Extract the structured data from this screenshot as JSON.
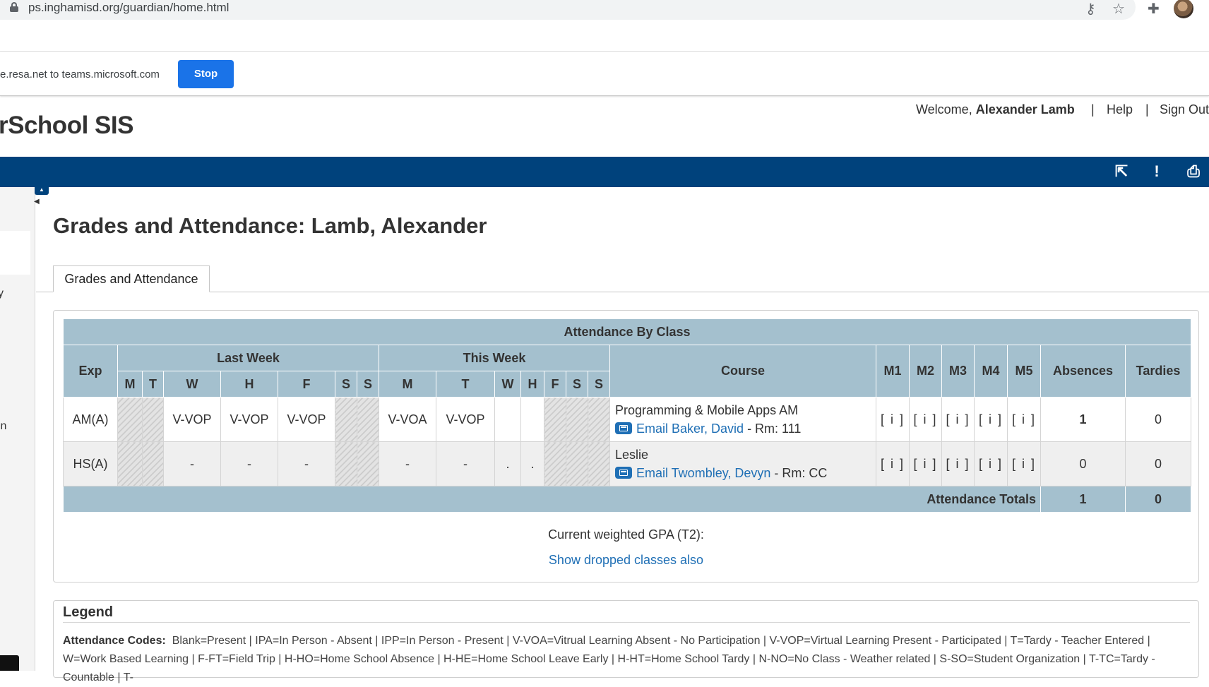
{
  "browser": {
    "url": "ps.inghamisd.org/guardian/home.html",
    "share_text": "e.resa.net to teams.microsoft.com",
    "stop_label": "Stop"
  },
  "header": {
    "brand": "rSchool SIS",
    "welcome_prefix": "Welcome, ",
    "user_name": "Alexander Lamb",
    "help": "Help",
    "sign_out": "Sign Out",
    "separator": "|"
  },
  "sidebar": {
    "fragments": [
      "y",
      "in"
    ]
  },
  "page": {
    "title": "Grades and Attendance: Lamb, Alexander",
    "tab": "Grades and Attendance"
  },
  "attendance": {
    "caption": "Attendance By Class",
    "headers": {
      "exp": "Exp",
      "last_week": "Last Week",
      "this_week": "This Week",
      "course": "Course",
      "m1": "M1",
      "m2": "M2",
      "m3": "M3",
      "m4": "M4",
      "m5": "M5",
      "absences": "Absences",
      "tardies": "Tardies"
    },
    "days": [
      "M",
      "T",
      "W",
      "H",
      "F",
      "S",
      "S"
    ],
    "rows": [
      {
        "exp": "AM(A)",
        "last_week": [
          "",
          "",
          "V-VOP",
          "V-VOP",
          "V-VOP",
          "",
          ""
        ],
        "this_week": [
          "V-VOA",
          "V-VOP",
          "",
          "",
          "",
          "",
          ""
        ],
        "course": "Programming & Mobile Apps AM",
        "email_label": "Email Baker, David",
        "room": " - Rm: 111",
        "marks": [
          "[ i ]",
          "[ i ]",
          "[ i ]",
          "[ i ]",
          "[ i ]"
        ],
        "absences": "1",
        "tardies": "0"
      },
      {
        "exp": "HS(A)",
        "last_week": [
          "",
          "",
          "-",
          "-",
          "-",
          "",
          ""
        ],
        "this_week": [
          "-",
          "-",
          ".",
          ".",
          "",
          "",
          ""
        ],
        "course": "Leslie",
        "email_label": "Email Twombley, Devyn",
        "room": " - Rm: CC",
        "marks": [
          "[ i ]",
          "[ i ]",
          "[ i ]",
          "[ i ]",
          "[ i ]"
        ],
        "absences": "0",
        "tardies": "0"
      }
    ],
    "totals_label": "Attendance Totals",
    "total_absences": "1",
    "total_tardies": "0"
  },
  "gpa_label": "Current weighted GPA (T2):",
  "dropped_link": "Show dropped classes also",
  "legend": {
    "title": "Legend",
    "codes_label": "Attendance Codes:",
    "codes_text": "Blank=Present | IPA=In Person - Absent | IPP=In Person - Present | V-VOA=Vitrual Learning Absent - No Participation | V-VOP=Virtual Learning Present - Participated | T=Tardy - Teacher Entered | W=Work Based Learning | F-FT=Field Trip | H-HO=Home School Absence | H-HE=Home School Leave Early | H-HT=Home School Tardy | N-NO=No Class - Weather related | S-SO=Student Organization | T-TC=Tardy - Countable | T-"
  },
  "colors": {
    "navbar": "#00427c",
    "table_header": "#a4c0ce",
    "link": "#1f6fb5",
    "stop_button": "#1a73e8"
  }
}
